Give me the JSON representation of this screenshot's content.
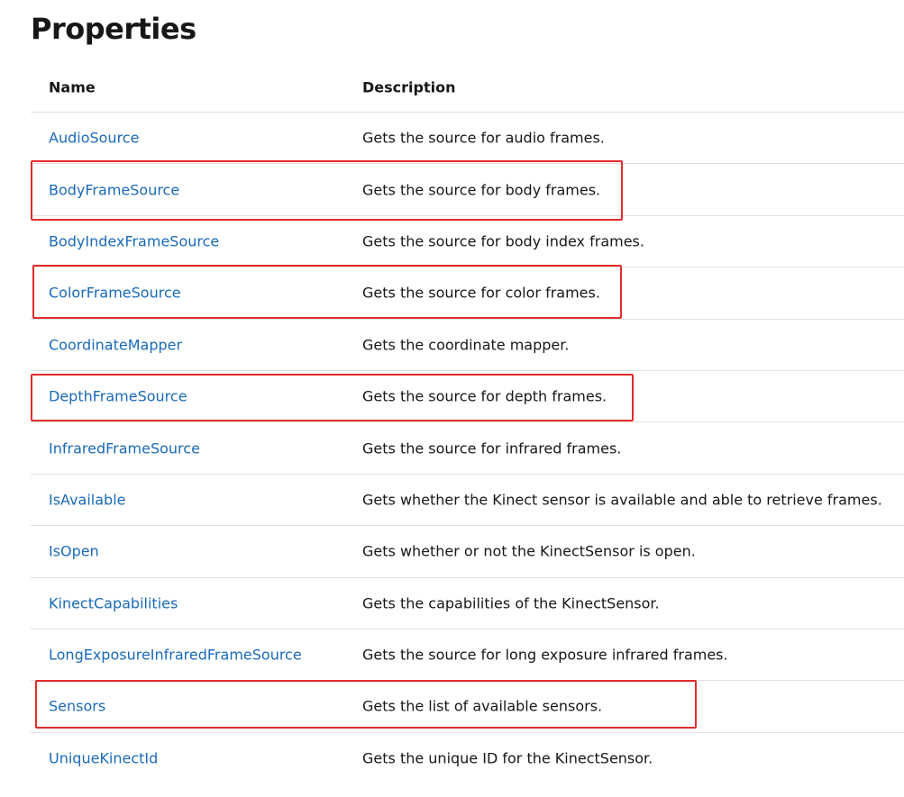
{
  "page": {
    "title": "Properties"
  },
  "table": {
    "headers": {
      "name": "Name",
      "description": "Description"
    },
    "rows": [
      {
        "name": "AudioSource",
        "description": "Gets the source for audio frames."
      },
      {
        "name": "BodyFrameSource",
        "description": "Gets the source for body frames."
      },
      {
        "name": "BodyIndexFrameSource",
        "description": "Gets the source for body index frames."
      },
      {
        "name": "ColorFrameSource",
        "description": "Gets the source for color frames."
      },
      {
        "name": "CoordinateMapper",
        "description": "Gets the coordinate mapper."
      },
      {
        "name": "DepthFrameSource",
        "description": "Gets the source for depth frames."
      },
      {
        "name": "InfraredFrameSource",
        "description": "Gets the source for infrared frames."
      },
      {
        "name": "IsAvailable",
        "description": "Gets whether the Kinect sensor is available and able to retrieve frames."
      },
      {
        "name": "IsOpen",
        "description": "Gets whether or not the KinectSensor is open."
      },
      {
        "name": "KinectCapabilities",
        "description": "Gets the capabilities of the KinectSensor."
      },
      {
        "name": "LongExposureInfraredFrameSource",
        "description": "Gets the source for long exposure infrared frames."
      },
      {
        "name": "Sensors",
        "description": "Gets the list of available sensors."
      },
      {
        "name": "UniqueKinectId",
        "description": "Gets the unique ID for the KinectSensor."
      }
    ]
  },
  "annotations": {
    "highlight_color": "#e42b2b",
    "highlighted_rows": [
      "BodyFrameSource",
      "ColorFrameSource",
      "DepthFrameSource",
      "Sensors"
    ]
  },
  "colors": {
    "link": "#1a6ab8",
    "text": "#171717",
    "divider": "#e1e1e1"
  }
}
